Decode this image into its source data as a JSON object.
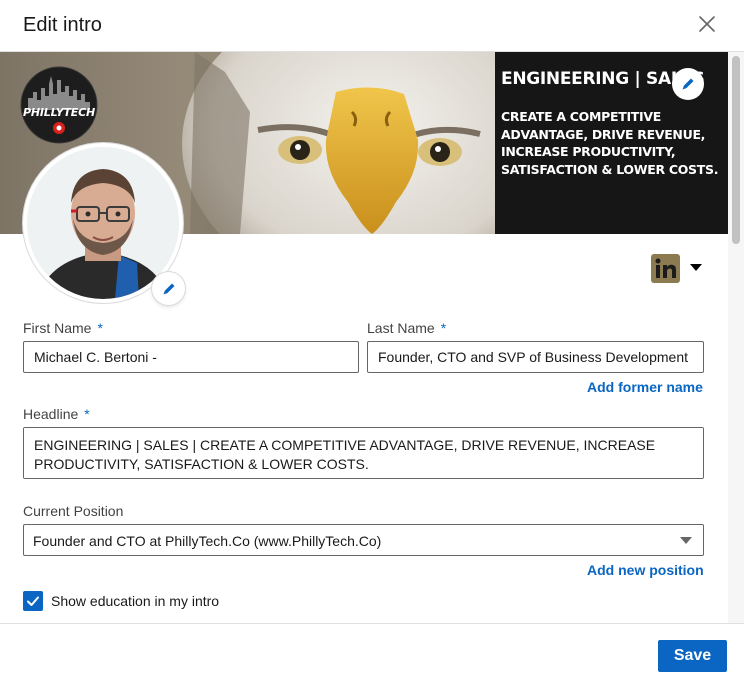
{
  "modal": {
    "title": "Edit intro",
    "close_icon": "close-icon"
  },
  "banner": {
    "headline": "ENGINEERING | SALES",
    "tagline": "CREATE A COMPETITIVE ADVANTAGE, DRIVE REVENUE, INCREASE PRODUCTIVITY, SATISFACTION & LOWER COSTS.",
    "logo_text": "PHILLYTECH",
    "edit_icon": "pencil-icon"
  },
  "profile": {
    "edit_icon": "pencil-icon",
    "network_icon": "linkedin-icon"
  },
  "form": {
    "first_name": {
      "label": "First Name",
      "required_mark": "*",
      "value": "Michael C. Bertoni -"
    },
    "last_name": {
      "label": "Last Name",
      "required_mark": "*",
      "value": "Founder, CTO and SVP of Business Development"
    },
    "add_former_name": "Add former name",
    "headline": {
      "label": "Headline",
      "required_mark": "*",
      "value": "ENGINEERING | SALES | CREATE A COMPETITIVE ADVANTAGE, DRIVE REVENUE, INCREASE PRODUCTIVITY, SATISFACTION & LOWER COSTS."
    },
    "current_position": {
      "label": "Current Position",
      "value": "Founder and CTO at PhillyTech.Co (www.PhillyTech.Co)"
    },
    "add_new_position": "Add new position",
    "show_education": {
      "label": "Show education in my intro",
      "checked": true
    }
  },
  "footer": {
    "save_label": "Save"
  },
  "colors": {
    "accent": "#0a66c2",
    "beak": "#e6b43a",
    "linkedin_badge": "#8c7a51"
  }
}
